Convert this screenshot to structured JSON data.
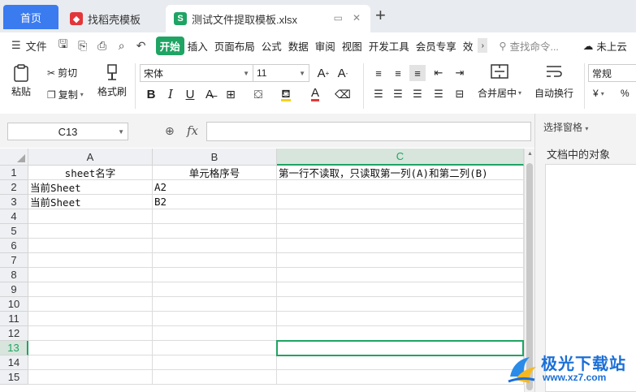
{
  "tabs": {
    "home": "首页",
    "template": "找稻壳模板",
    "file": "测试文件提取模板.xlsx",
    "new_tab": "+"
  },
  "menubar": {
    "file_label": "文件",
    "items": [
      "开始",
      "插入",
      "页面布局",
      "公式",
      "数据",
      "审阅",
      "视图",
      "开发工具",
      "会员专享",
      "效"
    ],
    "active_index": 0,
    "search": "查找命令...",
    "cloud": "未上云"
  },
  "ribbon": {
    "paste": "粘贴",
    "cut": "剪切",
    "copy": "复制",
    "format_painter": "格式刷",
    "font_name": "宋体",
    "font_size": "11",
    "merge_center": "合并居中",
    "wrap_text": "自动换行",
    "number_format": "常规",
    "currency_symbol": "¥",
    "percent_symbol": "%"
  },
  "formula_bar": {
    "cell_ref": "C13",
    "fx_label": "fx",
    "value": ""
  },
  "sheet": {
    "columns": [
      "A",
      "B",
      "C"
    ],
    "selected_column": "C",
    "rows": [
      "1",
      "2",
      "3",
      "4",
      "5",
      "6",
      "7",
      "8",
      "9",
      "10",
      "11",
      "12",
      "13",
      "14",
      "15"
    ],
    "selected_row": "13",
    "cells": [
      [
        "sheet名字",
        "单元格序号",
        "第一行不读取，只读取第一列(A)和第二列(B)"
      ],
      [
        "当前Sheet",
        "A2",
        ""
      ],
      [
        "当前Sheet",
        "B2",
        ""
      ]
    ]
  },
  "right_pane": {
    "title": "选择窗格",
    "subtitle": "文档中的对象"
  },
  "watermark": {
    "title": "极光下载站",
    "url": "www.xz7.com"
  },
  "colors": {
    "accent_green": "#1fa463",
    "home_blue": "#3a7bf0",
    "watermark_blue": "#1a6fd8"
  }
}
